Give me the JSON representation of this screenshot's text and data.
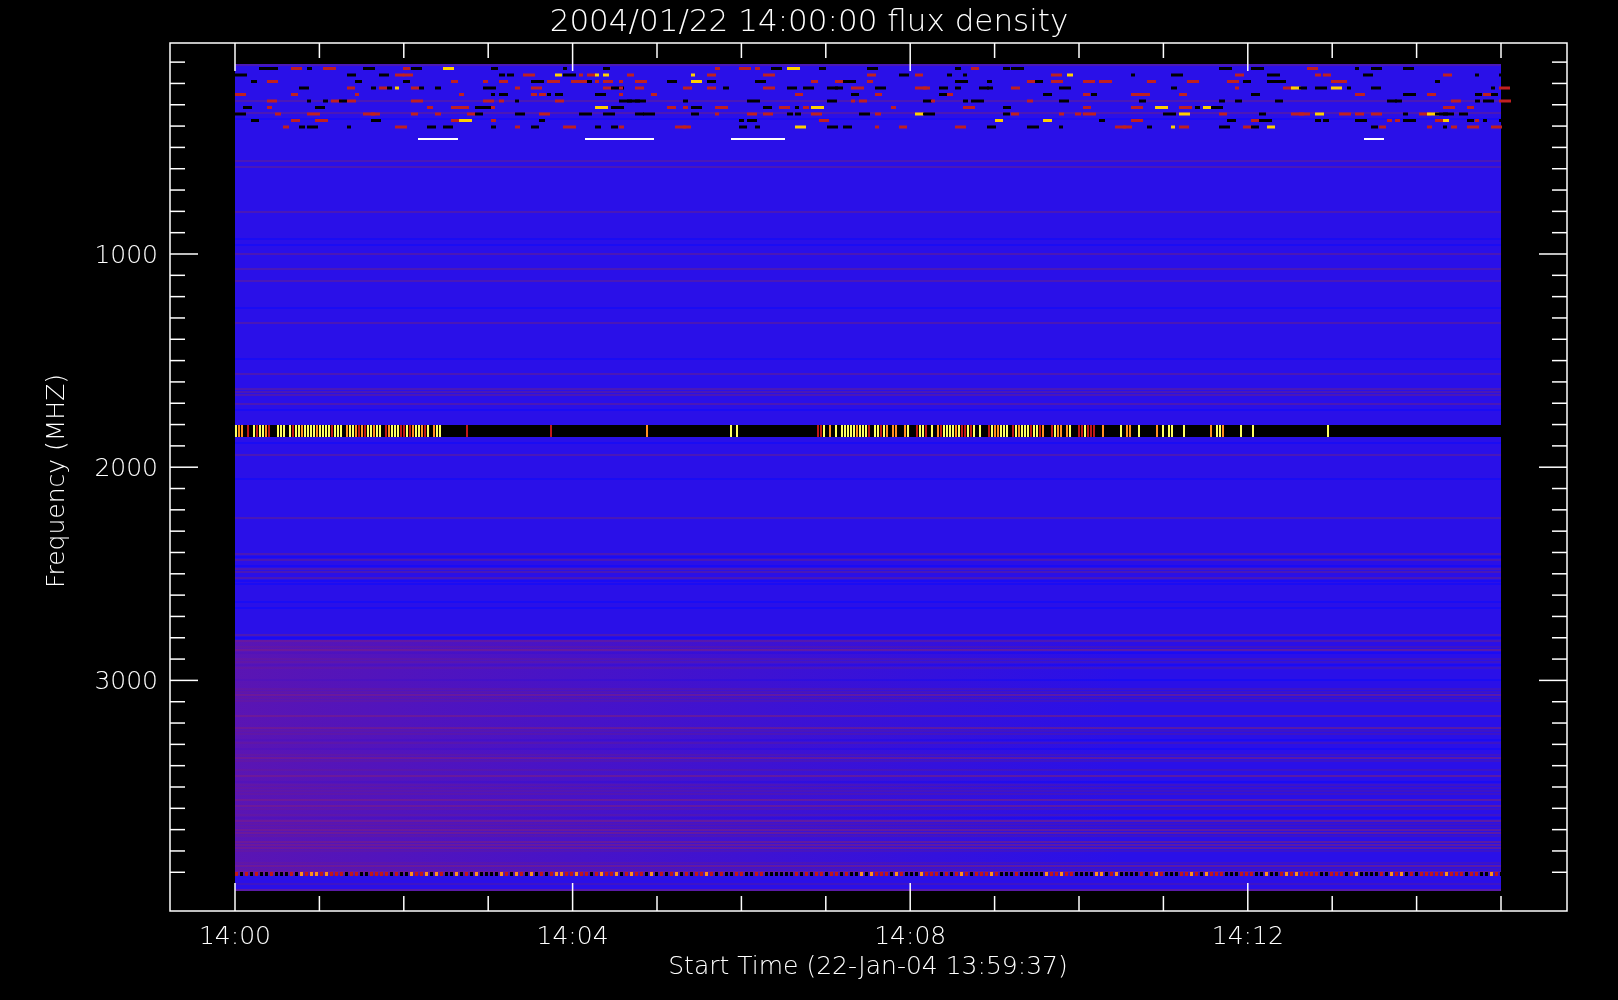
{
  "plot": {
    "title": "2004/01/22 14:00:00 flux density",
    "ylabel": "Frequency (MHZ)",
    "xlabel": "Start Time (22-Jan-04 13:59:37)",
    "ytick_labels": [
      "1000",
      "2000",
      "3000"
    ],
    "xtick_labels": [
      "14:00",
      "14:04",
      "14:08",
      "14:12"
    ]
  }
}
